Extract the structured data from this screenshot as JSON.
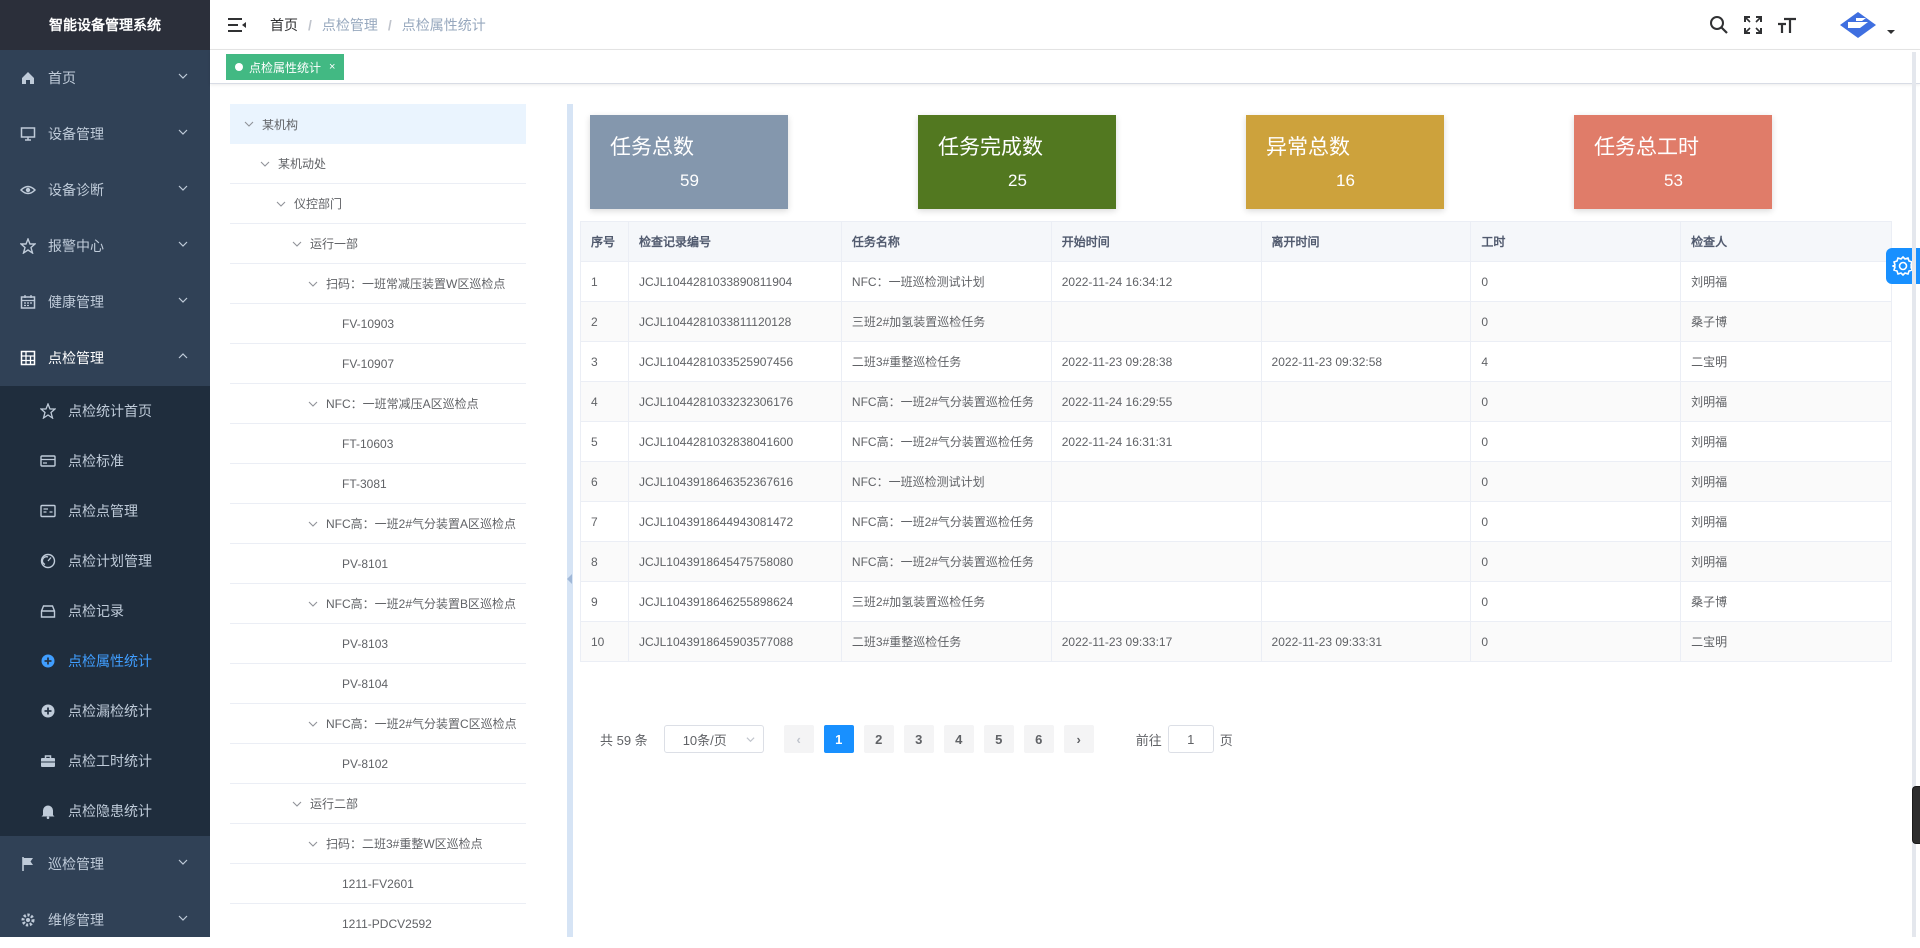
{
  "sidebar": {
    "title": "智能设备管理系统",
    "items": [
      {
        "label": "首页",
        "icon": "home-icon"
      },
      {
        "label": "设备管理",
        "icon": "monitor-icon"
      },
      {
        "label": "设备诊断",
        "icon": "eye-icon"
      },
      {
        "label": "报警中心",
        "icon": "star-icon"
      },
      {
        "label": "健康管理",
        "icon": "calendar-icon"
      },
      {
        "label": "点检管理",
        "icon": "grid-icon"
      }
    ],
    "sub_items": [
      {
        "label": "点检统计首页",
        "icon": "star-outline-icon"
      },
      {
        "label": "点检标准",
        "icon": "card-icon"
      },
      {
        "label": "点检点管理",
        "icon": "id-card-icon"
      },
      {
        "label": "点检计划管理",
        "icon": "gauge-icon"
      },
      {
        "label": "点检记录",
        "icon": "tray-icon"
      },
      {
        "label": "点检属性统计",
        "icon": "plus-circle-icon"
      },
      {
        "label": "点检漏检统计",
        "icon": "plus-circle-icon"
      },
      {
        "label": "点检工时统计",
        "icon": "briefcase-icon"
      },
      {
        "label": "点检隐患统计",
        "icon": "bell-icon"
      }
    ],
    "bottom_items": [
      {
        "label": "巡检管理",
        "icon": "flag-icon"
      },
      {
        "label": "维修管理",
        "icon": "settings-icon"
      }
    ]
  },
  "breadcrumb": [
    "首页",
    "点检管理",
    "点检属性统计"
  ],
  "breadcrumb_sep": "/",
  "tags": [
    {
      "label": "点检属性统计",
      "close": "×"
    }
  ],
  "tree": [
    {
      "label": "某机构",
      "level": 0,
      "arrow": true
    },
    {
      "label": "某机动处",
      "level": 1,
      "arrow": true
    },
    {
      "label": "仪控部门",
      "level": 2,
      "arrow": true
    },
    {
      "label": "运行一部",
      "level": 3,
      "arrow": true
    },
    {
      "label": "扫码：一班常减压装置W区巡检点",
      "level": 4,
      "arrow": true
    },
    {
      "label": "FV-10903",
      "level": 5,
      "arrow": false
    },
    {
      "label": "FV-10907",
      "level": 5,
      "arrow": false
    },
    {
      "label": "NFC：一班常减压A区巡检点",
      "level": 4,
      "arrow": true
    },
    {
      "label": "FT-10603",
      "level": 5,
      "arrow": false
    },
    {
      "label": "FT-3081",
      "level": 5,
      "arrow": false
    },
    {
      "label": "NFC高：一班2#气分装置A区巡检点",
      "level": 4,
      "arrow": true
    },
    {
      "label": "PV-8101",
      "level": 5,
      "arrow": false
    },
    {
      "label": "NFC高：一班2#气分装置B区巡检点",
      "level": 4,
      "arrow": true
    },
    {
      "label": "PV-8103",
      "level": 5,
      "arrow": false
    },
    {
      "label": "PV-8104",
      "level": 5,
      "arrow": false
    },
    {
      "label": "NFC高：一班2#气分装置C区巡检点",
      "level": 4,
      "arrow": true
    },
    {
      "label": "PV-8102",
      "level": 5,
      "arrow": false
    },
    {
      "label": "运行二部",
      "level": 3,
      "arrow": true
    },
    {
      "label": "扫码：二班3#重整W区巡检点",
      "level": 4,
      "arrow": true
    },
    {
      "label": "1211-FV2601",
      "level": 5,
      "arrow": false
    },
    {
      "label": "1211-PDCV2592",
      "level": 5,
      "arrow": false
    }
  ],
  "cards": [
    {
      "title": "任务总数",
      "value": "59",
      "color": "#8497ad"
    },
    {
      "title": "任务完成数",
      "value": "25",
      "color": "#527820"
    },
    {
      "title": "异常总数",
      "value": "16",
      "color": "#cda23c"
    },
    {
      "title": "任务总工时",
      "value": "53",
      "color": "#e07c69"
    }
  ],
  "table": {
    "columns": [
      "序号",
      "检查记录编号",
      "任务名称",
      "开始时间",
      "离开时间",
      "工时",
      "检查人"
    ],
    "rows": [
      [
        "1",
        "JCJL1044281033890811904",
        "NFC：一班巡检测试计划",
        "2022-11-24 16:34:12",
        "",
        "0",
        "刘明福"
      ],
      [
        "2",
        "JCJL1044281033811120128",
        "三班2#加氢装置巡检任务",
        "",
        "",
        "0",
        "桑子博"
      ],
      [
        "3",
        "JCJL1044281033525907456",
        "二班3#重整巡检任务",
        "2022-11-23 09:28:38",
        "2022-11-23 09:32:58",
        "4",
        "二宝明"
      ],
      [
        "4",
        "JCJL1044281033232306176",
        "NFC高：一班2#气分装置巡检任务",
        "2022-11-24 16:29:55",
        "",
        "0",
        "刘明福"
      ],
      [
        "5",
        "JCJL1044281032838041600",
        "NFC高：一班2#气分装置巡检任务",
        "2022-11-24 16:31:31",
        "",
        "0",
        "刘明福"
      ],
      [
        "6",
        "JCJL1043918646352367616",
        "NFC：一班巡检测试计划",
        "",
        "",
        "0",
        "刘明福"
      ],
      [
        "7",
        "JCJL1043918644943081472",
        "NFC高：一班2#气分装置巡检任务",
        "",
        "",
        "0",
        "刘明福"
      ],
      [
        "8",
        "JCJL1043918645475758080",
        "NFC高：一班2#气分装置巡检任务",
        "",
        "",
        "0",
        "刘明福"
      ],
      [
        "9",
        "JCJL1043918646255898624",
        "三班2#加氢装置巡检任务",
        "",
        "",
        "0",
        "桑子博"
      ],
      [
        "10",
        "JCJL1043918645903577088",
        "二班3#重整巡检任务",
        "2022-11-23 09:33:17",
        "2022-11-23 09:33:31",
        "0",
        "二宝明"
      ]
    ]
  },
  "pagination": {
    "total": "共 59 条",
    "page_size": "10条/页",
    "prev": "‹",
    "next": "›",
    "pages": [
      "1",
      "2",
      "3",
      "4",
      "5",
      "6"
    ],
    "current": "1",
    "goto_prefix": "前往",
    "goto_value": "1",
    "goto_suffix": "页"
  },
  "colors": {
    "sidebar_bg": "#304156",
    "accent": "#409eff",
    "active_page": "#1890ff",
    "tag": "#42b983"
  }
}
